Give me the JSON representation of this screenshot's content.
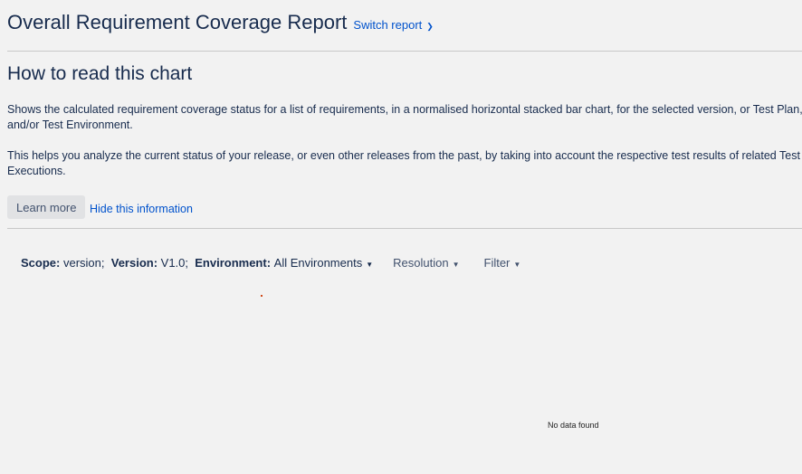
{
  "header": {
    "title": "Overall Requirement Coverage Report",
    "switch_report": "Switch report"
  },
  "info": {
    "heading": "How to read this chart",
    "paragraph1": "Shows the calculated requirement coverage status for a list of requirements, in a normalised horizontal stacked bar chart, for the selected version, or Test Plan, and/or Test Environment.",
    "paragraph2": "This helps you analyze the current status of your release, or even other releases from the past, by taking into account the respective test results of related Test Executions.",
    "learn_more": "Learn more",
    "hide": "Hide this information"
  },
  "filters": {
    "scope_label": "Scope:",
    "scope_value": "version;",
    "version_label": "Version:",
    "version_value": "V1.0;",
    "environment_label": "Environment:",
    "environment_value": "All Environments",
    "resolution": "Resolution",
    "filter": "Filter"
  },
  "chart": {
    "empty_message": "No data found"
  }
}
